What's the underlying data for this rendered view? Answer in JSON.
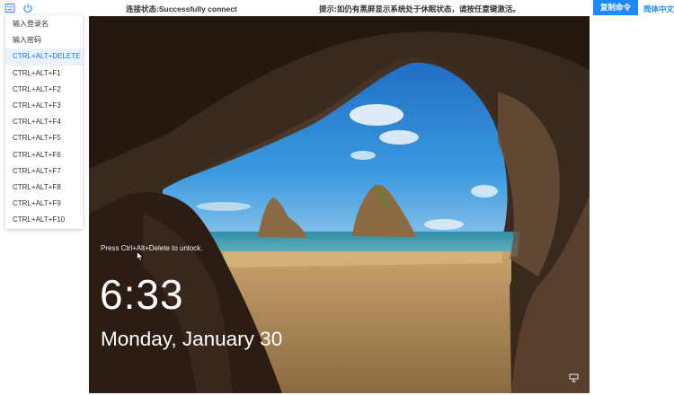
{
  "toolbar": {
    "keyboard_icon": "keyboard-icon",
    "power_icon": "power-icon",
    "status_text": "连接状态:Successfully connect",
    "hint_text": "提示:如仍有黑屏显示系统处于休眠状态，请按任意键激活。",
    "copy_label": "复制命令",
    "language_label": "简体中文",
    "accent_color": "#1e88ff"
  },
  "menu": {
    "items": [
      {
        "label": "输入登录名"
      },
      {
        "label": "输入密码"
      },
      {
        "label": "CTRL+ALT+DELETE"
      },
      {
        "label": "CTRL+ALT+F1"
      },
      {
        "label": "CTRL+ALT+F2"
      },
      {
        "label": "CTRL+ALT+F3"
      },
      {
        "label": "CTRL+ALT+F4"
      },
      {
        "label": "CTRL+ALT+F5"
      },
      {
        "label": "CTRL+ALT+F6"
      },
      {
        "label": "CTRL+ALT+F7"
      },
      {
        "label": "CTRL+ALT+F8"
      },
      {
        "label": "CTRL+ALT+F9"
      },
      {
        "label": "CTRL+ALT+F10"
      }
    ],
    "highlighted": "CTRL+ALT+DELETE"
  },
  "lockscreen": {
    "prompt": "Press Ctrl+Alt+Delete to unlock.",
    "time": "6:33",
    "date": "Monday, January 30",
    "ease_of_access_icon": "ease-of-access-icon"
  }
}
